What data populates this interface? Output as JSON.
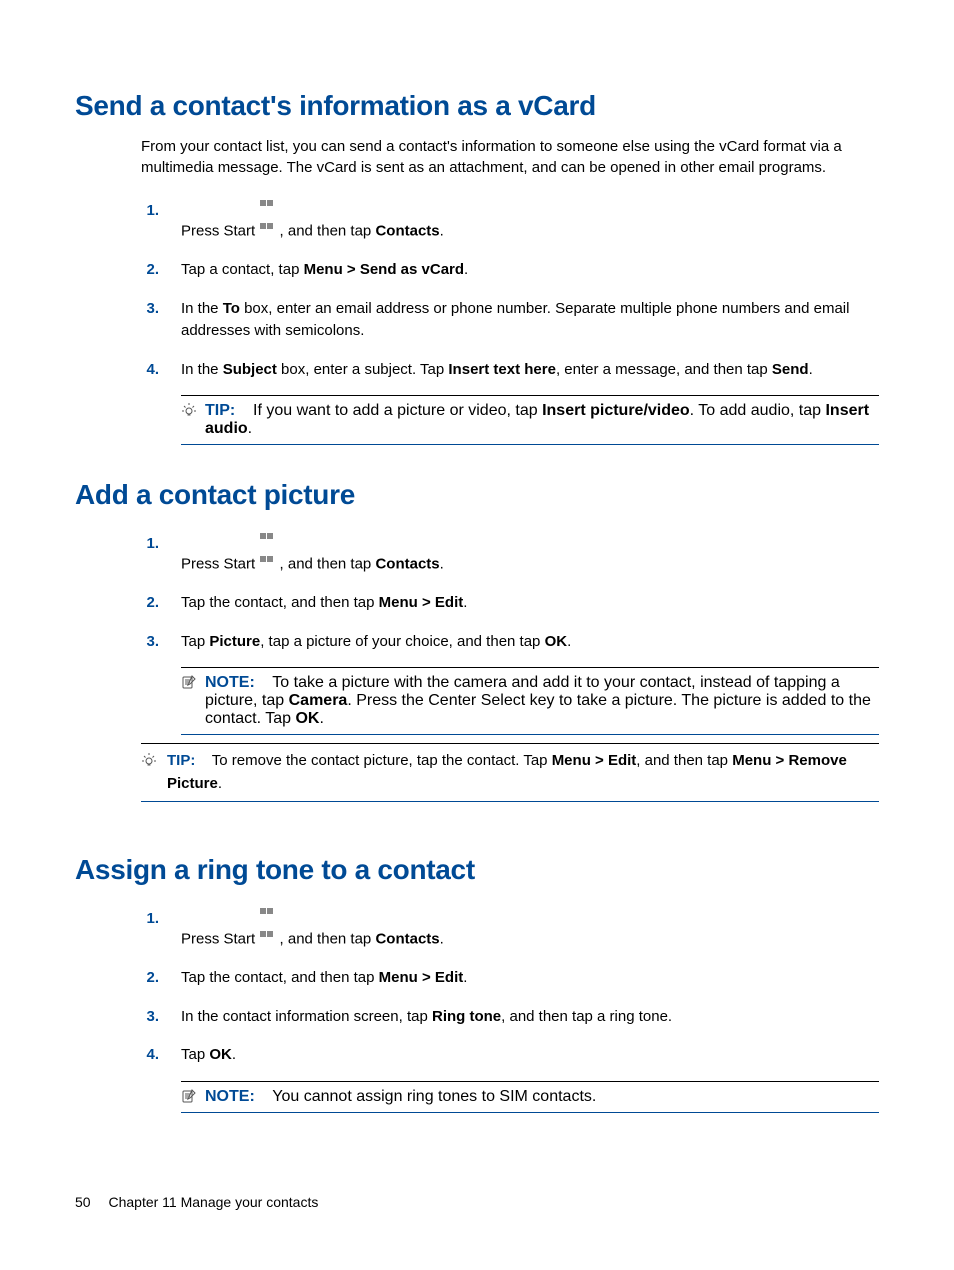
{
  "section1": {
    "heading": "Send a contact's information as a vCard",
    "intro": "From your contact list, you can send a contact's information to someone else using the vCard format via a multimedia message. The vCard is sent as an attachment, and can be opened in other email programs.",
    "steps": {
      "s1_pre": "Press Start ",
      "s1_post": ", and then tap ",
      "s1_bold": "Contacts",
      "s1_end": ".",
      "s2_a": "Tap a contact, tap ",
      "s2_b": "Menu > Send as vCard",
      "s2_c": ".",
      "s3_a": "In the ",
      "s3_b": "To",
      "s3_c": " box, enter an email address or phone number. Separate multiple phone numbers and email addresses with semicolons.",
      "s4_a": "In the ",
      "s4_b": "Subject",
      "s4_c": " box, enter a subject. Tap ",
      "s4_d": "Insert text here",
      "s4_e": ", enter a message, and then tap ",
      "s4_f": "Send",
      "s4_g": "."
    },
    "tip": {
      "label": "TIP:",
      "a": "If you want to add a picture or video, tap ",
      "b": "Insert picture/video",
      "c": ". To add audio, tap ",
      "d": "Insert audio",
      "e": "."
    }
  },
  "section2": {
    "heading": "Add a contact picture",
    "steps": {
      "s1_pre": "Press Start ",
      "s1_post": ", and then tap ",
      "s1_bold": "Contacts",
      "s1_end": ".",
      "s2_a": "Tap the contact, and then tap ",
      "s2_b": "Menu > Edit",
      "s2_c": ".",
      "s3_a": "Tap ",
      "s3_b": "Picture",
      "s3_c": ", tap a picture of your choice, and then tap ",
      "s3_d": "OK",
      "s3_e": "."
    },
    "note": {
      "label": "NOTE:",
      "a": "To take a picture with the camera and add it to your contact, instead of tapping a picture, tap ",
      "b": "Camera",
      "c": ". Press the Center Select key to take a picture. The picture is added to the contact. Tap ",
      "d": "OK",
      "e": "."
    },
    "tip": {
      "label": "TIP:",
      "a": "To remove the contact picture, tap the contact. Tap ",
      "b": "Menu > Edit",
      "c": ", and then tap ",
      "d": "Menu > Remove Picture",
      "e": "."
    }
  },
  "section3": {
    "heading": "Assign a ring tone to a contact",
    "steps": {
      "s1_pre": "Press Start ",
      "s1_post": ", and then tap ",
      "s1_bold": "Contacts",
      "s1_end": ".",
      "s2_a": "Tap the contact, and then tap ",
      "s2_b": "Menu > Edit",
      "s2_c": ".",
      "s3_a": "In the contact information screen, tap ",
      "s3_b": "Ring tone",
      "s3_c": ", and then tap a ring tone.",
      "s4_a": "Tap ",
      "s4_b": "OK",
      "s4_c": "."
    },
    "note": {
      "label": "NOTE:",
      "text": "You cannot assign ring tones to SIM contacts."
    }
  },
  "footer": {
    "page": "50",
    "chapter": "Chapter 11   Manage your contacts"
  },
  "nums": {
    "n1": "1.",
    "n2": "2.",
    "n3": "3.",
    "n4": "4."
  }
}
